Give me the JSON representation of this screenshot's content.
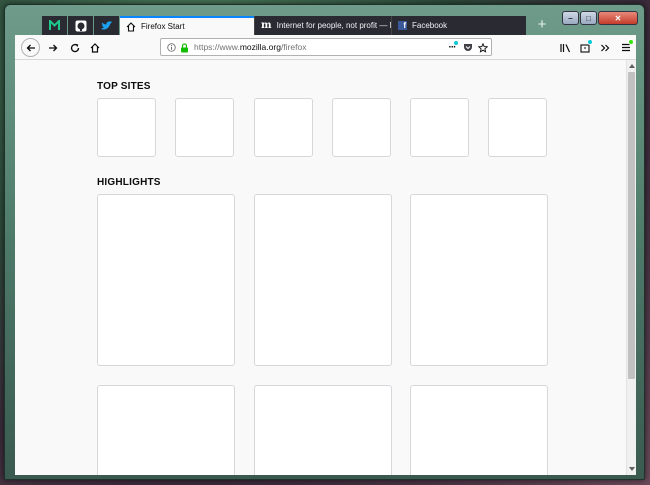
{
  "tabs": {
    "pinned": [
      {
        "icon": "meetup-green-icon",
        "color": "#1ec98b"
      },
      {
        "icon": "github-icon",
        "color": "#ffffff"
      },
      {
        "icon": "twitter-icon",
        "color": "#1da1f2"
      }
    ],
    "items": [
      {
        "label": "Firefox Start",
        "icon": "home-icon",
        "active": true
      },
      {
        "label": "Internet for people, not profit — Mo",
        "icon": "mozilla-m-icon",
        "active": false
      },
      {
        "label": "Facebook",
        "icon": "facebook-icon",
        "active": false
      }
    ],
    "new_tab": "+"
  },
  "window_controls": {
    "minimize": "–",
    "maximize": "□",
    "close": "✕"
  },
  "urlbar": {
    "prefix": "https://www.",
    "host": "mozilla.org",
    "path": "/firefox"
  },
  "content": {
    "top_sites_title": "TOP SITES",
    "highlights_title": "HIGHLIGHTS"
  },
  "colors": {
    "accent": "#0a84ff",
    "tab_dark": "#2a2a33",
    "badge_cyan": "#00c8d7",
    "badge_green": "#30e60b",
    "lock_green": "#12bc00"
  }
}
